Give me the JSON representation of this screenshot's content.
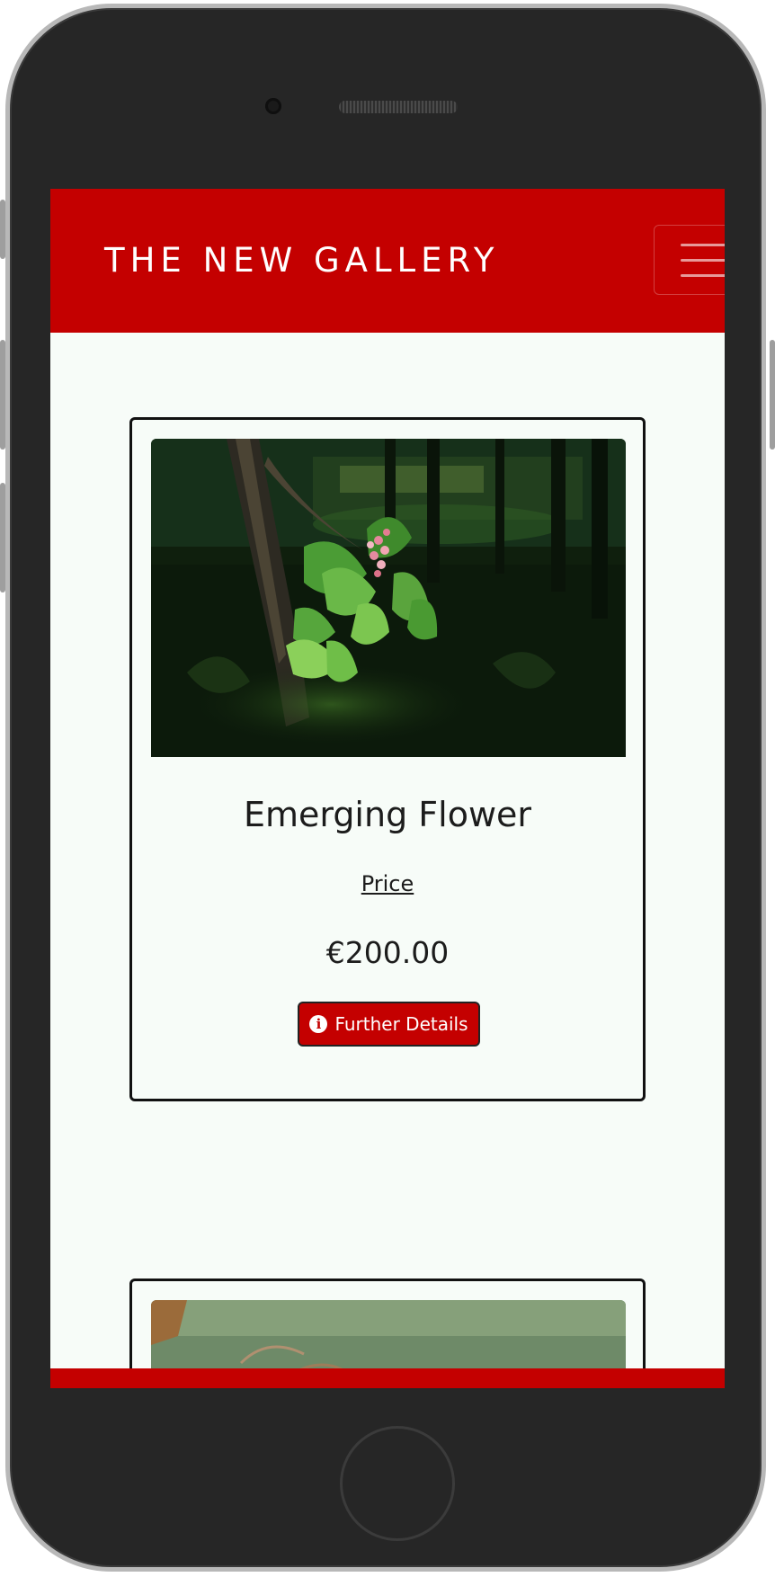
{
  "navbar": {
    "brand": "THE NEW GALLERY",
    "menu_icon": "hamburger-menu-icon",
    "background": "#c40000"
  },
  "products": [
    {
      "title": "Emerging Flower",
      "price_label": "Price",
      "price": "€200.00",
      "button_label": "Further Details",
      "button_icon": "info-circle-icon"
    },
    {
      "image": "grass-photo"
    }
  ],
  "colors": {
    "accent": "#c40000",
    "page_background": "#f7fcf8",
    "text": "#1c1c1c",
    "phone_frame": "#262626"
  }
}
